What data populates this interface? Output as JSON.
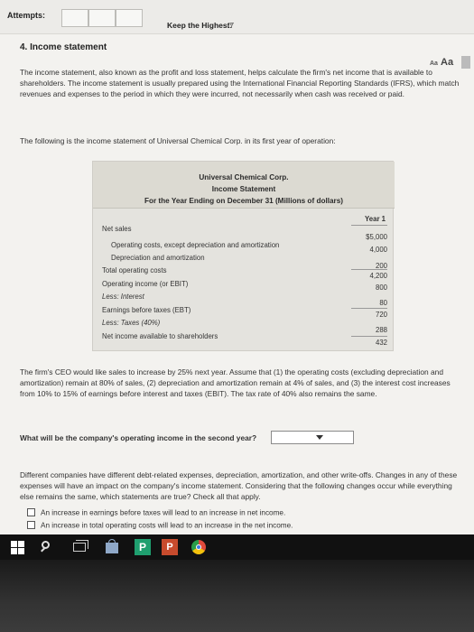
{
  "header": {
    "attempts_label": "Attempts:",
    "keep_label": "Keep the Highest:",
    "keep_value": "/7"
  },
  "question": {
    "title": "4. Income statement",
    "font_small": "Aa",
    "font_large": "Aa",
    "intro": "The income statement, also known as the profit and loss statement, helps calculate the firm's net income that is available to shareholders. The income statement is usually prepared using the International Financial Reporting Standards (IFRS), which match revenues and expenses to the period in which they were incurred, not necessarily when cash was received or paid.",
    "lead": "The following is the income statement of Universal Chemical Corp. in its first year of operation:"
  },
  "statement": {
    "company": "Universal Chemical Corp.",
    "name": "Income Statement",
    "period": "For the Year Ending on December 31 (Millions of dollars)",
    "year_header": "Year 1",
    "rows": [
      {
        "label": "Net sales",
        "value": "$5,000"
      },
      {
        "label": "Operating costs, except depreciation and amortization",
        "value": "4,000"
      },
      {
        "label": "Depreciation and amortization",
        "value": "200"
      },
      {
        "label": "Total operating costs",
        "value": "4,200"
      },
      {
        "label": "Operating income (or EBIT)",
        "value": "800"
      },
      {
        "label": "Less: Interest",
        "value": "80"
      },
      {
        "label": "Earnings before taxes (EBT)",
        "value": "720"
      },
      {
        "label": "Less: Taxes (40%)",
        "value": "288"
      },
      {
        "label": "Net income available to shareholders",
        "value": "432"
      }
    ]
  },
  "scenario": {
    "ceo_text": "The firm's CEO would like sales to increase by 25% next year. Assume that (1) the operating costs (excluding depreciation and amortization) remain at 80% of sales, (2) depreciation and amortization remain at 4% of sales, and (3) the interest cost increases from 10% to 15% of earnings before interest and taxes (EBIT). The tax rate of 40% also remains the same.",
    "prompt": "What will be the company's operating income in the second year?",
    "selected_value": ""
  },
  "followup": {
    "text": "Different companies have different debt-related expenses, depreciation, amortization, and other write-offs. Changes in any of these expenses will have an impact on the company's income statement. Considering that the following changes occur while everything else remains the same, which statements are true? Check all that apply.",
    "options": [
      {
        "label": "An increase in earnings before taxes will lead to an increase in net income.",
        "checked": false
      },
      {
        "label": "An increase in total operating costs will lead to an increase in the net income.",
        "checked": false
      }
    ]
  },
  "taskbar": {
    "icons": [
      "windows-icon",
      "search-icon",
      "task-view-icon",
      "store-icon",
      "publisher-icon",
      "powerpoint-icon",
      "chrome-icon"
    ],
    "publisher_glyph": "P",
    "powerpoint_glyph": "P"
  }
}
